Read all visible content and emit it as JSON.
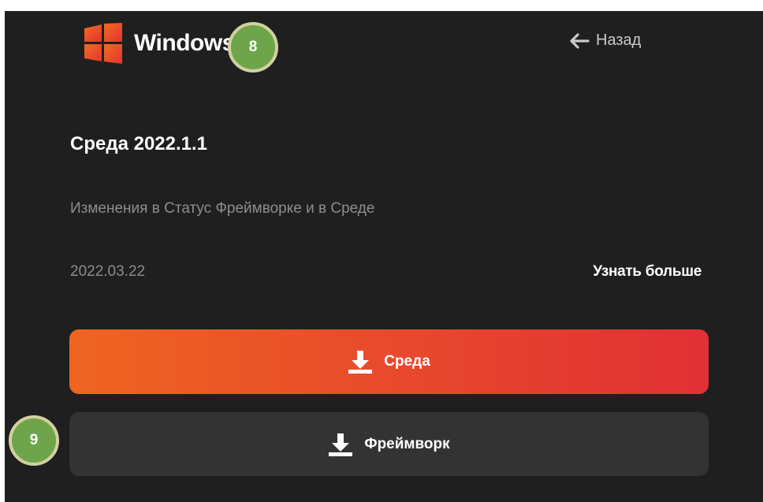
{
  "header": {
    "brand": "Windows",
    "back_label": "Назад",
    "logo_icon": "windows-logo-icon",
    "back_icon": "arrow-left-icon"
  },
  "release": {
    "title": "Среда 2022.1.1",
    "description": "Изменения в Статус Фреймворке и в Среде",
    "date": "2022.03.22",
    "learn_more": "Узнать больше"
  },
  "downloads": {
    "primary_label": "Среда",
    "secondary_label": "Фреймворк",
    "icon": "download-icon"
  },
  "annotations": {
    "badge_8": "8",
    "badge_9": "9"
  },
  "colors": {
    "background": "#1f1f1f",
    "accent_start": "#ee6520",
    "accent_end": "#e13035",
    "secondary_button": "#333333",
    "badge": "#6ea54a"
  }
}
